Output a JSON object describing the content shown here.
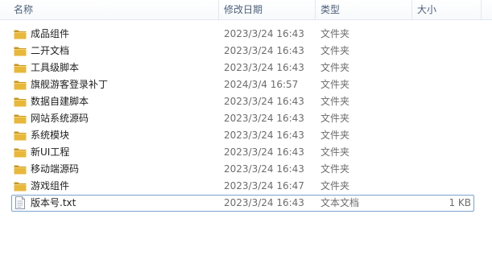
{
  "columns": {
    "name": "名称",
    "date": "修改日期",
    "type": "类型",
    "size": "大小"
  },
  "sort_indicator": "˄",
  "icons": {
    "folder": "folder-icon",
    "text_file": "text-file-icon",
    "folder_color": "#e8b83b",
    "folder_dark": "#c9961f"
  },
  "items": [
    {
      "name": "成品组件",
      "date": "2023/3/24 16:43",
      "type": "文件夹",
      "size": "",
      "icon": "folder"
    },
    {
      "name": "二开文档",
      "date": "2023/3/24 16:43",
      "type": "文件夹",
      "size": "",
      "icon": "folder"
    },
    {
      "name": "工具级脚本",
      "date": "2023/3/24 16:43",
      "type": "文件夹",
      "size": "",
      "icon": "folder"
    },
    {
      "name": "旗舰游客登录补丁",
      "date": "2024/3/4 16:57",
      "type": "文件夹",
      "size": "",
      "icon": "folder"
    },
    {
      "name": "数据自建脚本",
      "date": "2023/3/24 16:43",
      "type": "文件夹",
      "size": "",
      "icon": "folder"
    },
    {
      "name": "网站系统源码",
      "date": "2023/3/24 16:43",
      "type": "文件夹",
      "size": "",
      "icon": "folder"
    },
    {
      "name": "系统模块",
      "date": "2023/3/24 16:43",
      "type": "文件夹",
      "size": "",
      "icon": "folder"
    },
    {
      "name": "新UI工程",
      "date": "2023/3/24 16:43",
      "type": "文件夹",
      "size": "",
      "icon": "folder"
    },
    {
      "name": "移动端源码",
      "date": "2023/3/24 16:43",
      "type": "文件夹",
      "size": "",
      "icon": "folder"
    },
    {
      "name": "游戏组件",
      "date": "2023/3/24 16:47",
      "type": "文件夹",
      "size": "",
      "icon": "folder"
    },
    {
      "name": "版本号.txt",
      "date": "2023/3/24 16:43",
      "type": "文本文档",
      "size": "1 KB",
      "icon": "text_file"
    }
  ]
}
